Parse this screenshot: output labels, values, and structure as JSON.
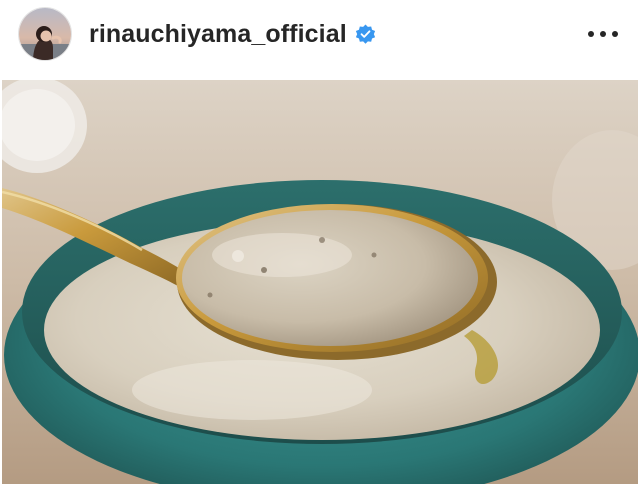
{
  "post": {
    "username": "rinauchiyama_official",
    "verified": true,
    "more_icon": "more-horizontal-icon",
    "avatar_icon": "profile-avatar",
    "photo_subject": "post-photo"
  },
  "colors": {
    "text": "#262626",
    "verified_blue": "#3897f0",
    "bowl_teal": "#2e8a88",
    "soup": "#d8cebc",
    "spoon_gold": "#c99a3c"
  }
}
